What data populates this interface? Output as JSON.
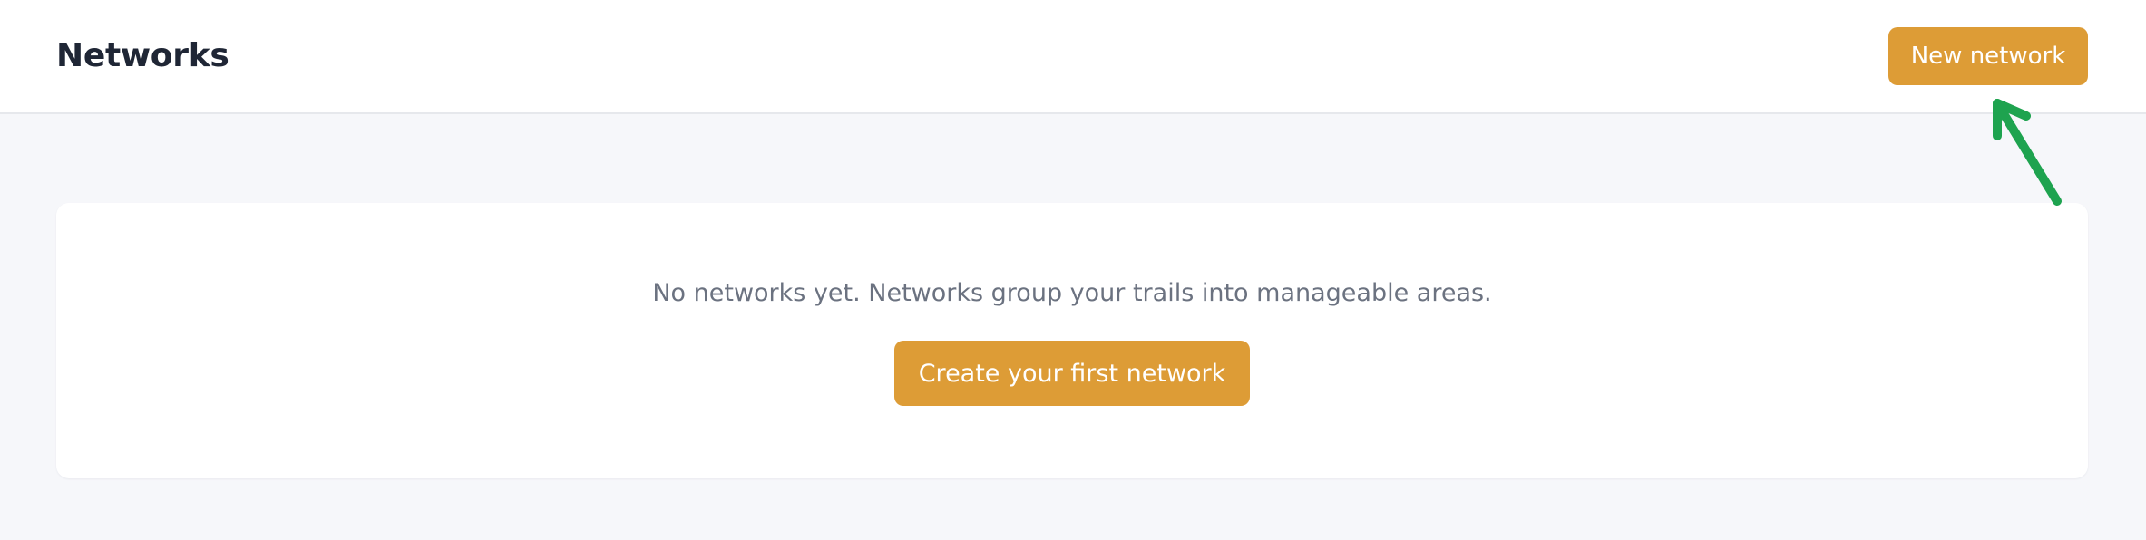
{
  "header": {
    "title": "Networks",
    "new_button_label": "New network"
  },
  "empty_state": {
    "message": "No networks yet. Networks group your trails into manageable areas.",
    "create_button_label": "Create your first network"
  },
  "colors": {
    "accent": "#dd9c36",
    "annotation_arrow": "#1ea34f",
    "page_background": "#f6f7fa",
    "title_text": "#1f2635",
    "muted_text": "#6b7280"
  },
  "icons": {
    "annotation": "arrow-up-left-icon"
  }
}
